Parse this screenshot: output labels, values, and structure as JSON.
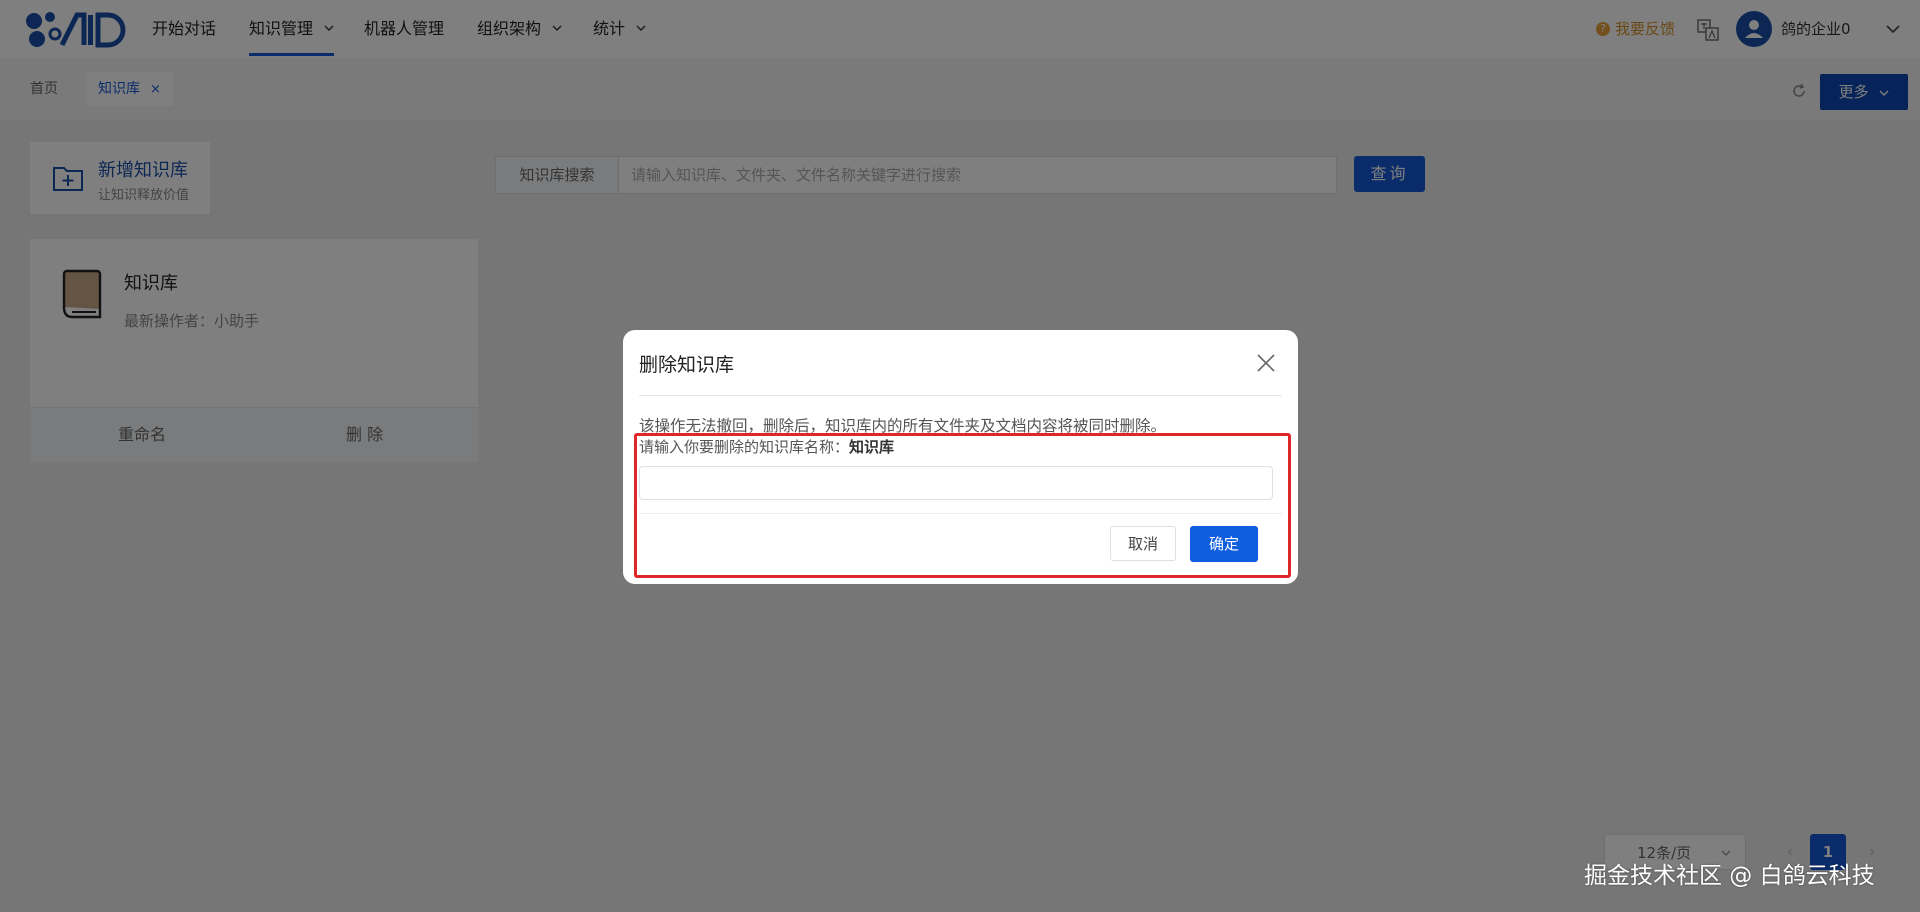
{
  "nav": {
    "items": [
      {
        "label": "开始对话",
        "has_dropdown": false,
        "active": false
      },
      {
        "label": "知识管理",
        "has_dropdown": true,
        "active": true
      },
      {
        "label": "机器人管理",
        "has_dropdown": false,
        "active": false
      },
      {
        "label": "组织架构",
        "has_dropdown": true,
        "active": false
      },
      {
        "label": "统计",
        "has_dropdown": true,
        "active": false
      }
    ],
    "feedback_label": "我要反馈",
    "username": "鸽的企业0",
    "accent_color": "#1659d6"
  },
  "tabs": {
    "home_label": "首页",
    "active_label": "知识库",
    "close_symbol": "×",
    "more_label": "更多"
  },
  "sidebar": {
    "add_kb_title": "新增知识库",
    "add_kb_subtitle": "让知识释放价值",
    "card": {
      "name": "知识库",
      "last_operator": "最新操作者：小助手",
      "rename_label": "重命名",
      "delete_label": "删 除"
    }
  },
  "search": {
    "label": "知识库搜索",
    "placeholder": "请输入知识库、文件夹、文件名称关键字进行搜索",
    "query_label": "查询"
  },
  "pagination": {
    "page_size": "12条/页",
    "current_page": "1",
    "prev_symbol": "‹",
    "next_symbol": "›"
  },
  "dialog": {
    "title": "删除知识库",
    "warning": "该操作无法撤回，删除后，知识库内的所有文件夹及文档内容将被同时删除。",
    "prompt": "请输入你要删除的知识库名称：",
    "prompt_name": "知识库",
    "input_value": "",
    "cancel_label": "取消",
    "ok_label": "确定",
    "highlight_color": "#e0262a"
  },
  "watermark": "掘金技术社区 @ 白鸽云科技"
}
